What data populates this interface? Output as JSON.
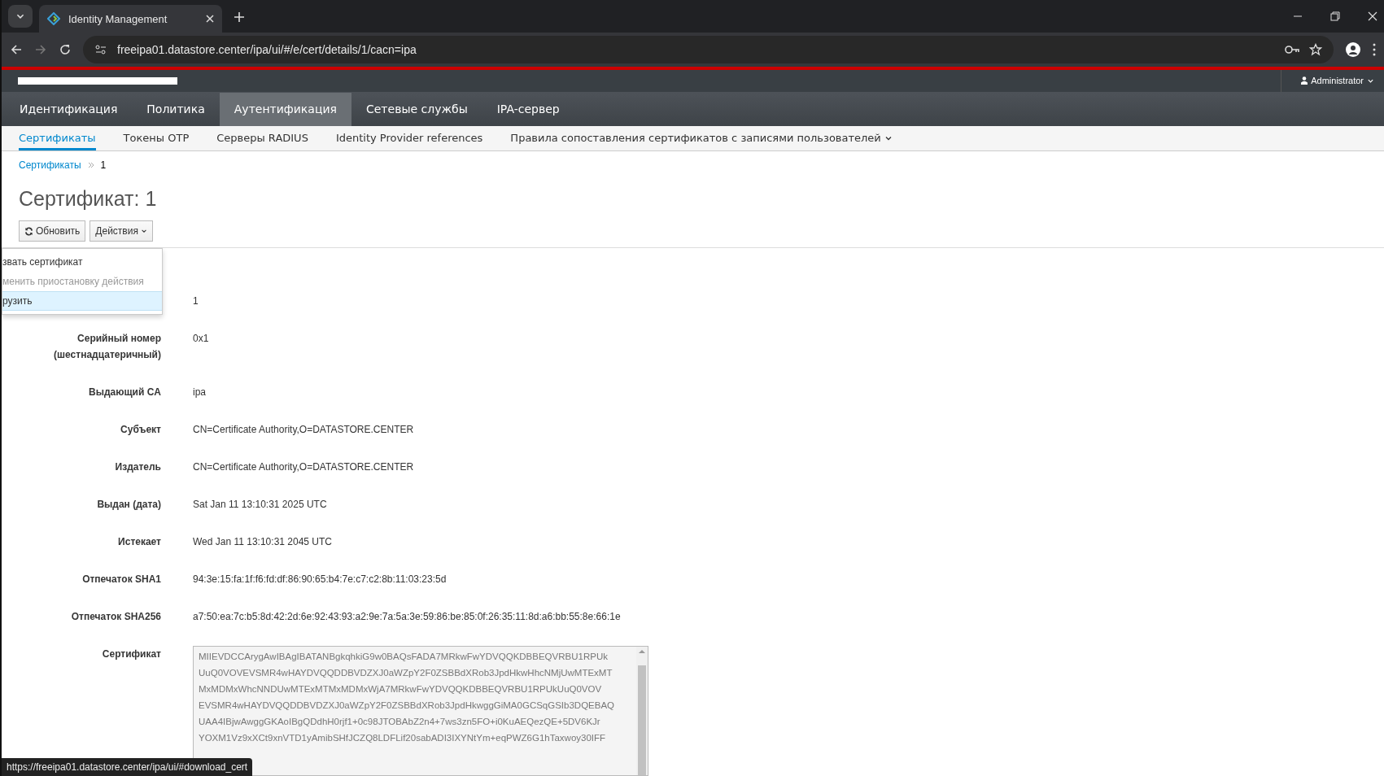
{
  "browser": {
    "tab_title": "Identity Management",
    "url": "freeipa01.datastore.center/ipa/ui/#/e/cert/details/1/cacn=ipa",
    "status_url": "https://freeipa01.datastore.center/ipa/ui/#download_cert"
  },
  "header": {
    "user": "Administrator"
  },
  "nav": [
    {
      "label": "Идентификация",
      "selected": false
    },
    {
      "label": "Политика",
      "selected": false
    },
    {
      "label": "Аутентификация",
      "selected": true
    },
    {
      "label": "Сетевые службы",
      "selected": false
    },
    {
      "label": "IPA-сервер",
      "selected": false
    }
  ],
  "subnav": [
    {
      "label": "Сертификаты",
      "selected": true,
      "dropdown": false
    },
    {
      "label": "Токены OTP",
      "selected": false,
      "dropdown": false
    },
    {
      "label": "Серверы RADIUS",
      "selected": false,
      "dropdown": false
    },
    {
      "label": "Identity Provider references",
      "selected": false,
      "dropdown": false
    },
    {
      "label": "Правила сопоставления сертификатов с записями пользователей",
      "selected": false,
      "dropdown": true
    }
  ],
  "breadcrumb": {
    "link": "Сертификаты",
    "current": "1"
  },
  "title": "Сертификат: 1",
  "buttons": [
    {
      "kind": "refresh",
      "label": "Обновить"
    },
    {
      "kind": "menu",
      "label": "Действия"
    }
  ],
  "actions_menu": [
    {
      "label": "звать сертификат",
      "disabled": false,
      "selected": false
    },
    {
      "label": "менить приостановку действия",
      "disabled": true,
      "selected": false
    },
    {
      "label": "рузить",
      "disabled": false,
      "selected": true
    }
  ],
  "fields": [
    {
      "value": "1"
    },
    {
      "label": "Серийный номер (шестнадцатеричный)",
      "value": "0x1"
    },
    {
      "label": "Выдающий CA",
      "value": "ipa"
    },
    {
      "label": "Субъект",
      "value": "CN=Certificate Authority,O=DATASTORE.CENTER"
    },
    {
      "label": "Издатель",
      "value": "CN=Certificate Authority,O=DATASTORE.CENTER"
    },
    {
      "label": "Выдан (дата)",
      "value": "Sat Jan 11 13:10:31 2025 UTC"
    },
    {
      "label": "Истекает",
      "value": "Wed Jan 11 13:10:31 2045 UTC"
    },
    {
      "label": "Отпечаток SHA1",
      "value": "94:3e:15:fa:1f:f6:fd:df:86:90:65:b4:7e:c7:c2:8b:11:03:23:5d"
    },
    {
      "label": "Отпечаток SHA256",
      "value": "a7:50:ea:7c:b5:8d:42:2d:6e:92:43:93:a2:9e:7a:5a:3e:59:86:be:85:0f:26:35:11:8d:a6:bb:55:8e:66:1e"
    }
  ],
  "certificate": {
    "label": "Сертификат",
    "lines": [
      "MIIEVDCCArygAwIBAgIBATANBgkqhkiG9w0BAQsFADA7MRkwFwYDVQQKDBBEQVRBU1RPUk",
      "UuQ0VOVEVSMR4wHAYDVQQDDBVDZXJ0aWZpY2F0ZSBBdXRob3JpdHkwHhcNMjUwMTExMT",
      "MxMDMxWhcNNDUwMTExMTMxMDMxWjA7MRkwFwYDVQQKDBBEQVRBU1RPUkUuQ0VOV",
      "EVSMR4wHAYDVQQDDBVDZXJ0aWZpY2F0ZSBBdXRob3JpdHkwggGiMA0GCSqGSIb3DQEBAQ",
      "UAA4IBjwAwggGKAoIBgQDdhH0rjf1+0c98JTOBAbZ2n4+7ws3zn5FO+i0KuAEQezQE+5DV6KJr",
      "YOXM1Vz9xXCt9xnVTD1yAmibSHfJCZQ8LDFLif20sabADI3IXYNtYm+eqPWZ6G1hTaxwoy30IFF"
    ]
  }
}
